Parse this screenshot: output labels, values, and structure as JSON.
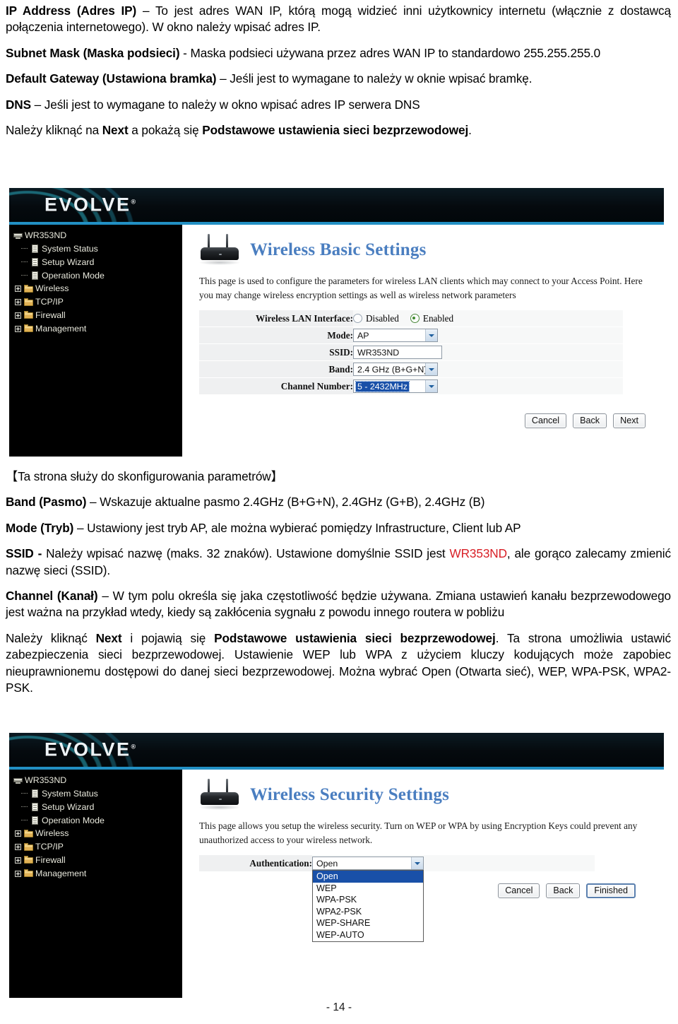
{
  "document": {
    "paragraphs": [
      {
        "id": "p-ip-address",
        "runs": [
          {
            "text": "IP Address (Adres IP) ",
            "bold": true
          },
          {
            "text": "– To jest adres WAN IP, którą mogą widzieć inni użytkownicy internetu (włącznie z dostawcą połączenia internetowego). W okno należy wpisać adres IP.",
            "bold": false
          }
        ]
      },
      {
        "id": "p-subnet-mask",
        "runs": [
          {
            "text": "Subnet Mask (Maska podsieci) ",
            "bold": true
          },
          {
            "text": "- Maska podsieci używana przez adres WAN IP to standardowo 255.255.255.0",
            "bold": false
          }
        ]
      },
      {
        "id": "p-default-gateway",
        "runs": [
          {
            "text": "Default Gateway (Ustawiona bramka) ",
            "bold": true
          },
          {
            "text": "– Jeśli jest to wymagane to należy w oknie wpisać bramkę.",
            "bold": false
          }
        ]
      },
      {
        "id": "p-dns",
        "runs": [
          {
            "text": "DNS ",
            "bold": true
          },
          {
            "text": "– Jeśli jest to wymagane to należy w okno wpisać adres IP serwera DNS",
            "bold": false
          }
        ]
      },
      {
        "id": "p-click-next-1",
        "runs": [
          {
            "text": "Należy kliknąć na ",
            "bold": false
          },
          {
            "text": "Next",
            "bold": true
          },
          {
            "text": " a pokażą się ",
            "bold": false
          },
          {
            "text": "Podstawowe ustawienia sieci bezprzewodowej",
            "bold": true
          },
          {
            "text": ".",
            "bold": false
          }
        ]
      }
    ],
    "paragraphs_mid": [
      {
        "id": "p-bracket-note",
        "runs": [
          {
            "text": "【Ta strona służy do skonfigurowania parametrów】",
            "bold": false
          }
        ]
      },
      {
        "id": "p-band",
        "runs": [
          {
            "text": "Band (Pasmo) ",
            "bold": true
          },
          {
            "text": "– Wskazuje aktualne pasmo 2.4GHz (B+G+N), 2.4GHz (G+B), 2.4GHz (B)",
            "bold": false
          }
        ]
      },
      {
        "id": "p-mode",
        "runs": [
          {
            "text": "Mode (Tryb) ",
            "bold": true
          },
          {
            "text": "– Ustawiony jest tryb  AP, ale można wybierać pomiędzy Infrastructure, Client lub AP",
            "bold": false
          }
        ]
      },
      {
        "id": "p-ssid",
        "runs": [
          {
            "text": "SSID  -  ",
            "bold": true
          },
          {
            "text": "Należy wpisać nazwę (maks. 32 znaków). Ustawione domyślnie SSID jest ",
            "bold": false
          },
          {
            "text": "WR353ND",
            "bold": false,
            "color": "red"
          },
          {
            "text": ", ale gorąco zalecamy zmienić nazwę sieci (SSID).",
            "bold": false
          }
        ]
      },
      {
        "id": "p-channel",
        "runs": [
          {
            "text": "Channel (Kanał) ",
            "bold": true
          },
          {
            "text": "– W tym polu określa się jaka częstotliwość będzie używana. Zmiana ustawień kanału bezprzewodowego jest ważna na przykład wtedy, kiedy są zakłócenia sygnału z powodu innego routera w pobliżu",
            "bold": false
          }
        ]
      },
      {
        "id": "p-click-next-2",
        "runs": [
          {
            "text": "Należy kliknąć ",
            "bold": false
          },
          {
            "text": "Next",
            "bold": true
          },
          {
            "text": " i pojawią się ",
            "bold": false
          },
          {
            "text": "Podstawowe ustawienia sieci bezprzewodowej",
            "bold": true
          },
          {
            "text": ". Ta strona umożliwia ustawić zabezpieczenia sieci bezprzewodowej. Ustawienie WEP lub WPA z użyciem kluczy kodujących może zapobiec nieuprawnionemu dostępowi do danej sieci bezprzewodowej. Można wybrać Open (Otwarta sieć), WEP, WPA-PSK, WPA2-PSK.",
            "bold": false
          }
        ]
      }
    ],
    "page_number": "- 14 -",
    "accent_red": "#d81f26"
  },
  "router_ui_basic": {
    "brand": "EVOLVE",
    "brand_reg": "®",
    "accent_bar_color": "#2290c4",
    "sidebar": {
      "root_label": "WR353ND",
      "items": [
        {
          "label": "System Status",
          "icon": "page-icon",
          "type": "leaf"
        },
        {
          "label": "Setup Wizard",
          "icon": "page-icon",
          "type": "leaf"
        },
        {
          "label": "Operation Mode",
          "icon": "page-icon",
          "type": "leaf"
        },
        {
          "label": "Wireless",
          "icon": "folder-icon",
          "type": "folder"
        },
        {
          "label": "TCP/IP",
          "icon": "folder-icon",
          "type": "folder"
        },
        {
          "label": "Firewall",
          "icon": "folder-icon",
          "type": "folder"
        },
        {
          "label": "Management",
          "icon": "folder-icon",
          "type": "folder"
        }
      ]
    },
    "title": "Wireless Basic Settings",
    "description": "This page is used to configure the parameters for wireless LAN clients which may connect to your Access Point. Here you may change wireless encryption settings as well as wireless network parameters",
    "form": {
      "wireless_lan_interface": {
        "label": "Wireless LAN Interface:",
        "option_disabled": "Disabled",
        "option_enabled": "Enabled",
        "selected": "Enabled"
      },
      "mode": {
        "label": "Mode:",
        "value": "AP"
      },
      "ssid": {
        "label": "SSID:",
        "value": "WR353ND"
      },
      "band": {
        "label": "Band:",
        "value": "2.4 GHz (B+G+N)"
      },
      "channel_number": {
        "label": "Channel Number:",
        "value": "5 - 2432MHz"
      }
    },
    "buttons": {
      "cancel": "Cancel",
      "back": "Back",
      "next": "Next"
    }
  },
  "router_ui_security": {
    "brand": "EVOLVE",
    "brand_reg": "®",
    "accent_bar_color": "#2290c4",
    "sidebar": {
      "root_label": "WR353ND",
      "items": [
        {
          "label": "System Status",
          "icon": "page-icon",
          "type": "leaf"
        },
        {
          "label": "Setup Wizard",
          "icon": "page-icon",
          "type": "leaf"
        },
        {
          "label": "Operation Mode",
          "icon": "page-icon",
          "type": "leaf"
        },
        {
          "label": "Wireless",
          "icon": "folder-icon",
          "type": "folder"
        },
        {
          "label": "TCP/IP",
          "icon": "folder-icon",
          "type": "folder"
        },
        {
          "label": "Firewall",
          "icon": "folder-icon",
          "type": "folder"
        },
        {
          "label": "Management",
          "icon": "folder-icon",
          "type": "folder"
        }
      ]
    },
    "title": "Wireless Security Settings",
    "description": "This page allows you setup the wireless security. Turn on WEP or WPA by using Encryption Keys could prevent any unauthorized access to your wireless network.",
    "form": {
      "authentication": {
        "label": "Authentication:",
        "value": "Open",
        "options": [
          "Open",
          "WEP",
          "WPA-PSK",
          "WPA2-PSK",
          "WEP-SHARE",
          "WEP-AUTO"
        ],
        "highlighted": "Open"
      }
    },
    "buttons": {
      "cancel": "Cancel",
      "back": "Back",
      "finished": "Finished"
    }
  }
}
